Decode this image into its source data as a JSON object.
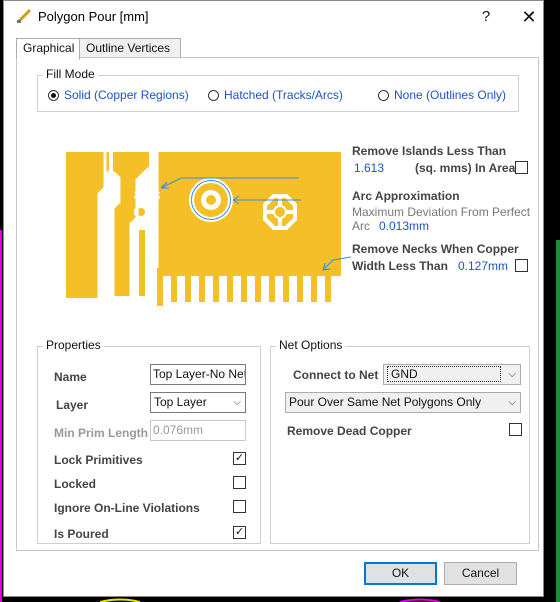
{
  "window": {
    "title": "Polygon Pour [mm]",
    "help": "?",
    "close": "✕"
  },
  "tabs": [
    "Graphical",
    "Outline Vertices"
  ],
  "fill_mode": {
    "label": "Fill Mode",
    "options": [
      "Solid (Copper Regions)",
      "Hatched (Tracks/Arcs)",
      "None (Outlines Only)"
    ],
    "selected": "Solid (Copper Regions)"
  },
  "diagram": {
    "remove_islands": {
      "title": "Remove Islands Less Than",
      "value": "1.613",
      "unit": "(sq. mms) In Area",
      "checked": false
    },
    "arc_approx": {
      "title": "Arc Approximation",
      "desc1": "Maximum Deviation From Perfect",
      "desc2": "Arc",
      "value": "0.013mm"
    },
    "remove_necks": {
      "title": "Remove Necks When Copper",
      "title2": "Width Less Than",
      "value": "0.127mm",
      "checked": false
    }
  },
  "properties": {
    "label": "Properties",
    "name_label": "Name",
    "name_value": "Top Layer-No Net",
    "layer_label": "Layer",
    "layer_value": "Top Layer",
    "min_prim_label": "Min Prim Length",
    "min_prim_value": "0.076mm",
    "lock_primitives": {
      "label": "Lock Primitives",
      "checked": true
    },
    "locked": {
      "label": "Locked",
      "checked": false
    },
    "ignore_violations": {
      "label": "Ignore On-Line Violations",
      "checked": false
    },
    "is_poured": {
      "label": "Is Poured",
      "checked": true
    }
  },
  "net_options": {
    "label": "Net Options",
    "connect_label": "Connect to Net",
    "connect_value": "GND",
    "pour_mode": "Pour Over Same Net Polygons Only",
    "remove_dead": {
      "label": "Remove Dead Copper",
      "checked": false
    }
  },
  "buttons": {
    "ok": "OK",
    "cancel": "Cancel"
  },
  "colors": {
    "copper": "#f5bf27",
    "accent_blue": "#1b55c4",
    "arrow_blue": "#2f8fe0"
  }
}
